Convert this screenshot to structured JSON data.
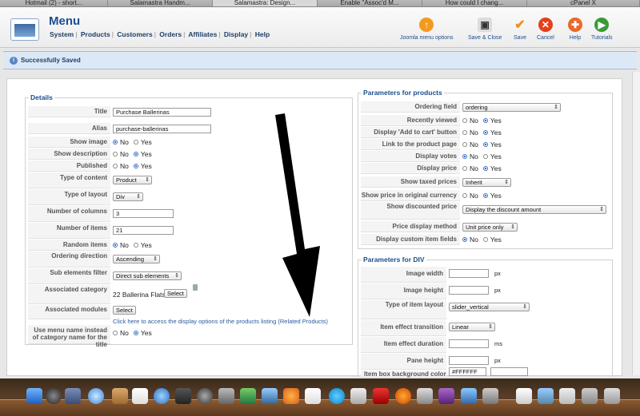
{
  "browser_tabs": [
    "Hotmail (2) - short...",
    "Salamastra Handm...",
    "Salamastra: Design...",
    "Enable \"Assoc'd M...",
    "How could I chang...",
    "cPanel X"
  ],
  "header": {
    "title": "Menu",
    "menu": [
      "System",
      "Products",
      "Customers",
      "Orders",
      "Affiliates",
      "Display",
      "Help"
    ],
    "toolbar": {
      "joomla": "Joomla menu options",
      "save_close": "Save & Close",
      "save": "Save",
      "cancel": "Cancel",
      "help": "Help",
      "tutorials": "Tutorials"
    }
  },
  "message": "Successfully Saved",
  "details": {
    "legend": "Details",
    "title_label": "Title",
    "title_value": "Purchase Ballerinas",
    "alias_label": "Alias",
    "alias_value": "purchase-ballerinas",
    "show_image_label": "Show image",
    "show_description_label": "Show description",
    "published_label": "Published",
    "type_content_label": "Type of content",
    "type_content_value": "Product",
    "type_layout_label": "Type of layout",
    "type_layout_value": "Div",
    "num_columns_label": "Number of columns",
    "num_columns_value": "3",
    "num_items_label": "Number of items",
    "num_items_value": "21",
    "random_items_label": "Random items",
    "ordering_direction_label": "Ordering direction",
    "ordering_direction_value": "Ascending",
    "sub_elements_label": "Sub elements filter",
    "sub_elements_value": "Direct sub elements",
    "associated_category_label": "Associated category",
    "associated_category_value": "22 Ballerina Flats",
    "associated_modules_label": "Associated modules",
    "select_label": "Select",
    "products_link": "Click here to access the display options of the products listing (Related Products)",
    "use_menu_name_label": "Use menu name instead of category name for the title",
    "no": "No",
    "yes": "Yes"
  },
  "params_products": {
    "legend": "Parameters for products",
    "ordering_field_label": "Ordering field",
    "ordering_field_value": "ordering",
    "recently_viewed_label": "Recently viewed",
    "add_to_cart_label": "Display 'Add to cart' button",
    "link_product_page_label": "Link to the product page",
    "display_votes_label": "Display votes",
    "display_price_label": "Display price",
    "show_taxed_label": "Show taxed prices",
    "show_taxed_value": "Inherit",
    "show_original_currency_label": "Show price in original currency",
    "show_discounted_label": "Show discounted price",
    "show_discounted_value": "Display the discount amount",
    "price_display_label": "Price display method",
    "price_display_value": "Unit price only",
    "custom_item_fields_label": "Display custom item fields"
  },
  "params_div": {
    "legend": "Parameters for DIV",
    "image_width_label": "Image width",
    "image_height_label": "Image height",
    "type_item_layout_label": "Type of item layout",
    "type_item_layout_value": "slider_vertical",
    "item_effect_transition_label": "Item effect transition",
    "item_effect_transition_value": "Linear",
    "item_effect_duration_label": "Item effect duration",
    "pane_height_label": "Pane height",
    "item_box_bg_label": "Item box background color",
    "item_box_bg_value": "#FFFFFF",
    "px": "px",
    "ms": "ms"
  },
  "colors": {
    "accent": "#1b4e8e",
    "arrow": "#000000"
  }
}
